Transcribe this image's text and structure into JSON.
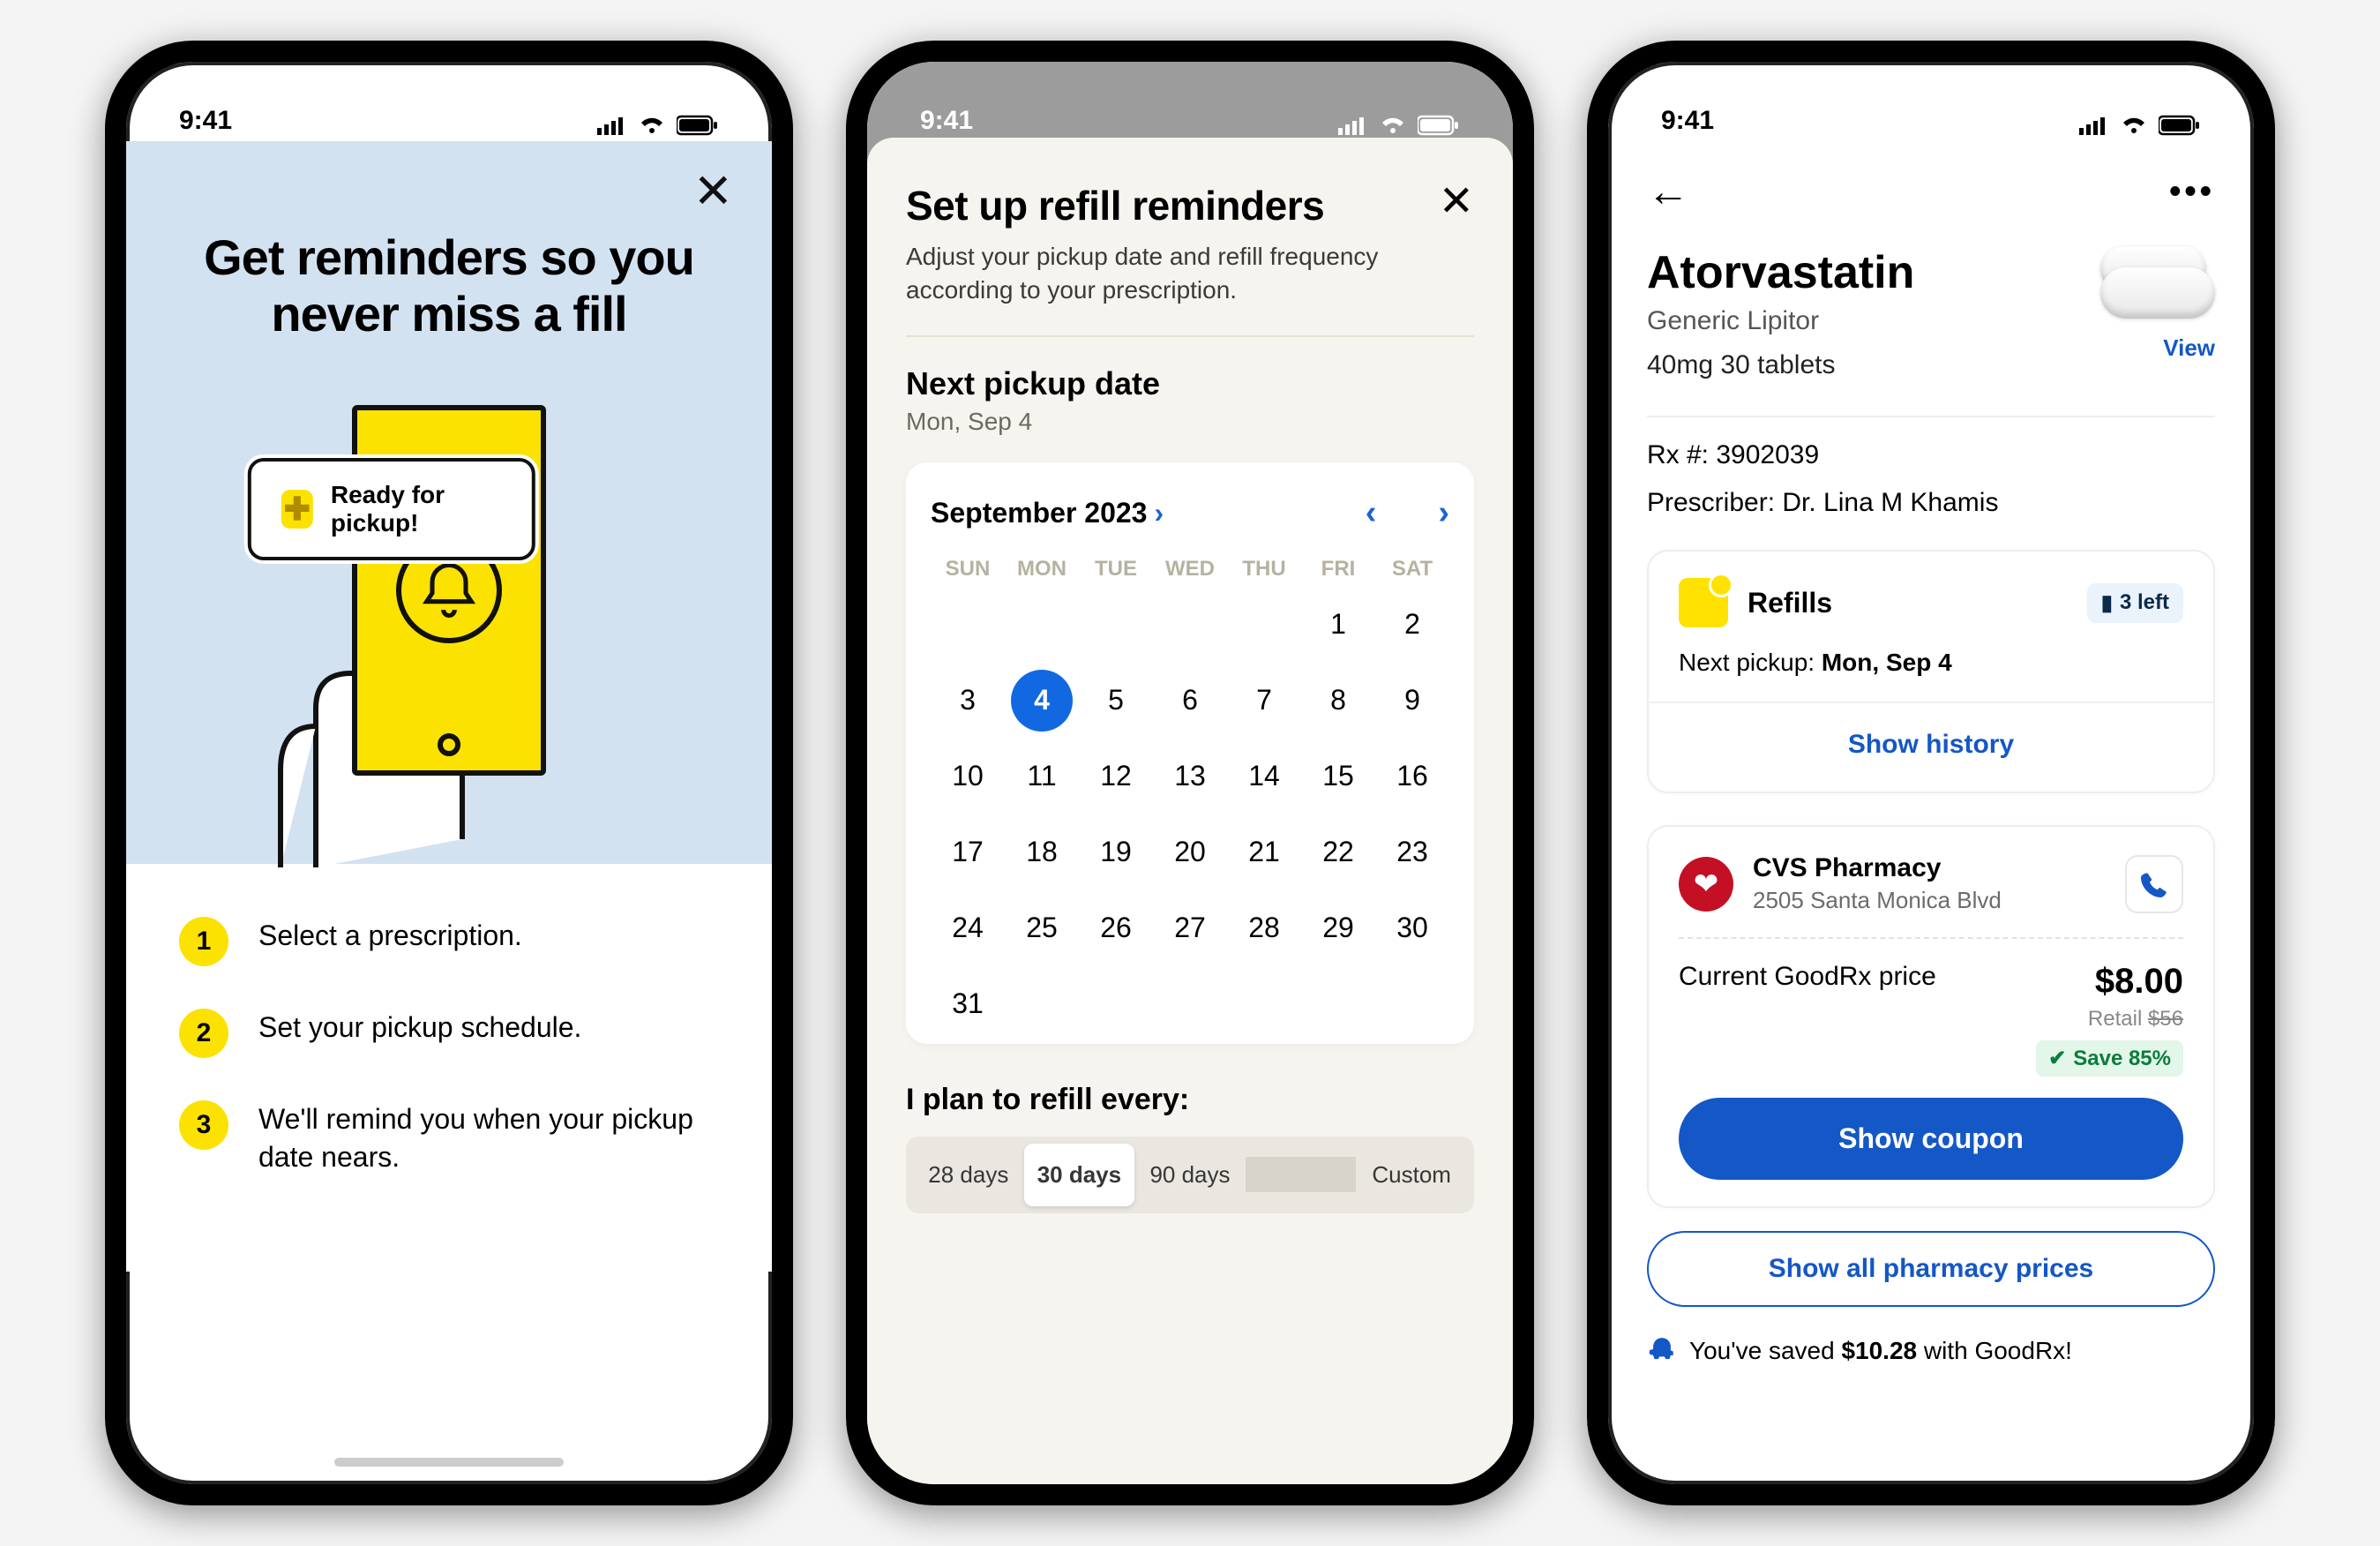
{
  "status_bar": {
    "time": "9:41"
  },
  "screen1": {
    "title_line1": "Get reminders so you",
    "title_line2": "never miss a fill",
    "notification": "Ready for pickup!",
    "steps": [
      "Select a prescription.",
      "Set your pickup schedule.",
      "We'll remind you when your pickup date nears."
    ]
  },
  "screen2": {
    "title": "Set up refill reminders",
    "subtitle": "Adjust your pickup date and refill frequency according to your prescription.",
    "next_pickup_label": "Next pickup date",
    "next_pickup_value": "Mon, Sep 4",
    "calendar": {
      "month_label": "September 2023",
      "dow": [
        "SUN",
        "MON",
        "TUE",
        "WED",
        "THU",
        "FRI",
        "SAT"
      ],
      "first_weekday_index": 5,
      "days_in_month": 31,
      "selected_day": 4
    },
    "plan_label": "I plan to refill every:",
    "segments": [
      "28 days",
      "30 days",
      "90 days",
      "Custom"
    ],
    "segment_selected_index": 1
  },
  "screen3": {
    "drug": {
      "name": "Atorvastatin",
      "generic": "Generic Lipitor",
      "dose": "40mg 30 tablets",
      "view_label": "View"
    },
    "rx_number": "Rx #: 3902039",
    "prescriber": "Prescriber: Dr. Lina M Khamis",
    "refills_card": {
      "title": "Refills",
      "count_chip": "3 left",
      "next_pickup_label": "Next pickup: ",
      "next_pickup_value": "Mon, Sep 4",
      "show_history": "Show history"
    },
    "pharmacy_card": {
      "name": "CVS Pharmacy",
      "address": "2505 Santa Monica Blvd",
      "price_label": "Current GoodRx price",
      "price_value": "$8.00",
      "retail_prefix": "Retail ",
      "retail_value": "$56",
      "save_badge": "Save 85%",
      "coupon_btn": "Show coupon"
    },
    "show_all_btn": "Show all pharmacy prices",
    "savings_prefix": "You've saved ",
    "savings_value": "$10.28",
    "savings_suffix": " with GoodRx!"
  }
}
